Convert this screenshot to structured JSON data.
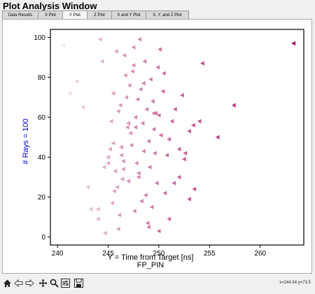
{
  "window": {
    "title": "Plot Analysis Window"
  },
  "tabs": [
    {
      "label": "Data Results",
      "active": false
    },
    {
      "label": "X Plot",
      "active": false
    },
    {
      "label": "Y Plot",
      "active": true
    },
    {
      "label": "Z Plot",
      "active": false
    },
    {
      "label": "X and Y Plot",
      "active": false
    },
    {
      "label": "X, Y, and Z Plot",
      "active": false
    }
  ],
  "toolbar": {
    "icons": [
      "home-icon",
      "back-icon",
      "forward-icon",
      "pan-icon",
      "zoom-icon",
      "configure-subplots-icon",
      "save-icon"
    ]
  },
  "status": {
    "coords": "x=244.54 y=73.5"
  },
  "chart_data": {
    "type": "scatter",
    "title": "",
    "xlabel": "Y = Time from Target [ns]",
    "xlabel2": "FP_PIN",
    "ylabel": "# Rays = 100",
    "xlim": [
      239.3,
      264.3
    ],
    "ylim": [
      -4,
      104
    ],
    "xticks": [
      240,
      245,
      250,
      255,
      260
    ],
    "yticks": [
      0,
      20,
      40,
      60,
      80,
      100
    ],
    "marker": "left-triangle",
    "color_low": "#f3e6f0",
    "color_high": "#a6005a",
    "ylabel_color": "#0000cc",
    "x": [
      240.6,
      241.2,
      241.9,
      242.5,
      243.3,
      244.0,
      244.2,
      244.4,
      244.7,
      245.0,
      245.2,
      245.3,
      245.4,
      245.5,
      245.6,
      245.7,
      245.8,
      245.9,
      246.0,
      246.1,
      246.2,
      246.3,
      246.4,
      246.5,
      246.6,
      246.7,
      246.8,
      246.9,
      247.0,
      247.1,
      247.2,
      247.3,
      247.4,
      247.5,
      247.6,
      247.7,
      247.8,
      247.9,
      248.0,
      248.1,
      248.2,
      248.3,
      248.4,
      248.5,
      248.6,
      248.7,
      248.8,
      248.9,
      249.0,
      249.1,
      249.2,
      249.3,
      249.4,
      249.5,
      249.6,
      249.7,
      249.8,
      249.9,
      250.0,
      250.1,
      250.2,
      250.4,
      250.6,
      250.8,
      251.0,
      251.3,
      251.6,
      252.0,
      252.3,
      252.6,
      253.0,
      253.4,
      254.3,
      255.8,
      257.4,
      263.3,
      245.0,
      245.5,
      246.0,
      246.5,
      247.0,
      247.5,
      248.0,
      248.5,
      249.0,
      249.5,
      250.0,
      250.5,
      251.0,
      251.5,
      252.0,
      252.5,
      253.0,
      253.5,
      254.0,
      244.0,
      243.0,
      244.6,
      246.3,
      247.7
    ],
    "y": [
      96,
      72,
      78,
      65,
      14,
      9,
      99,
      88,
      2,
      37,
      44,
      58,
      17,
      72,
      23,
      33,
      93,
      25,
      63,
      11,
      66,
      41,
      29,
      34,
      91,
      81,
      70,
      55,
      28,
      76,
      52,
      46,
      83,
      95,
      13,
      60,
      37,
      69,
      32,
      99,
      74,
      18,
      57,
      43,
      88,
      21,
      64,
      7,
      48,
      35,
      79,
      15,
      68,
      54,
      42,
      62,
      27,
      85,
      3,
      94,
      51,
      73,
      22,
      41,
      49,
      58,
      64,
      30,
      71,
      42,
      19,
      56,
      87,
      50,
      66,
      97,
      40,
      47,
      4,
      38,
      57,
      86,
      30,
      77,
      5,
      62,
      61,
      82,
      9,
      27,
      44,
      39,
      53,
      24,
      58,
      14,
      25,
      35,
      45,
      55
    ]
  }
}
